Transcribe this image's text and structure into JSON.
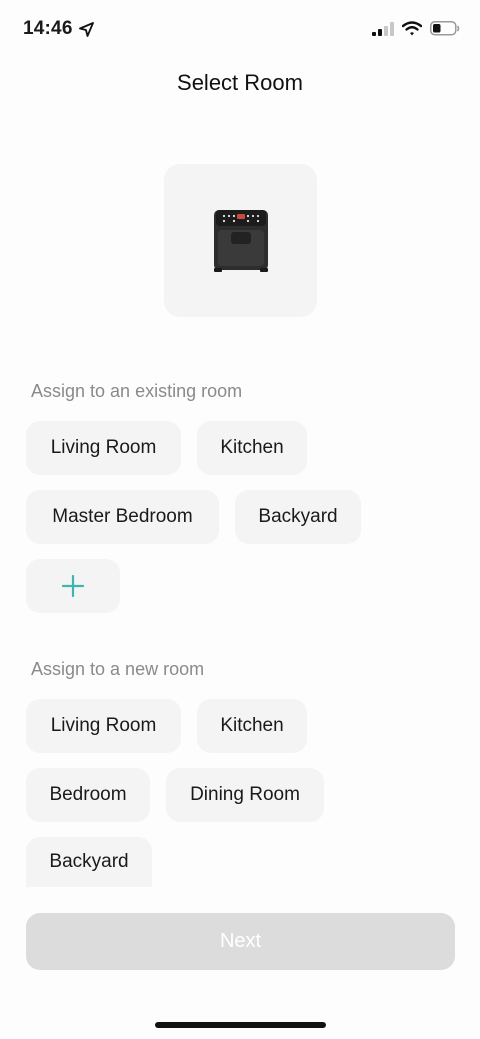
{
  "status_bar": {
    "time": "14:46",
    "icons": [
      "location-arrow-icon",
      "cellular-signal-icon",
      "wifi-icon",
      "battery-icon"
    ],
    "battery_level": 0.35
  },
  "header": {
    "title": "Select Room"
  },
  "device": {
    "icon": "air-fryer-icon"
  },
  "existing_rooms": {
    "label": "Assign to an existing room",
    "items": [
      "Living Room",
      "Kitchen",
      "Master Bedroom",
      "Backyard"
    ],
    "add_icon": "plus-icon"
  },
  "new_rooms": {
    "label": "Assign to a new room",
    "items": [
      "Living Room",
      "Kitchen",
      "Bedroom",
      "Dining Room",
      "Backyard"
    ]
  },
  "footer": {
    "next_label": "Next",
    "next_enabled": false
  },
  "colors": {
    "accent": "#3fb5b0",
    "chip_bg": "#f4f4f4",
    "disabled_button": "#dcdcdc",
    "label_gray": "#8a8a8a"
  }
}
